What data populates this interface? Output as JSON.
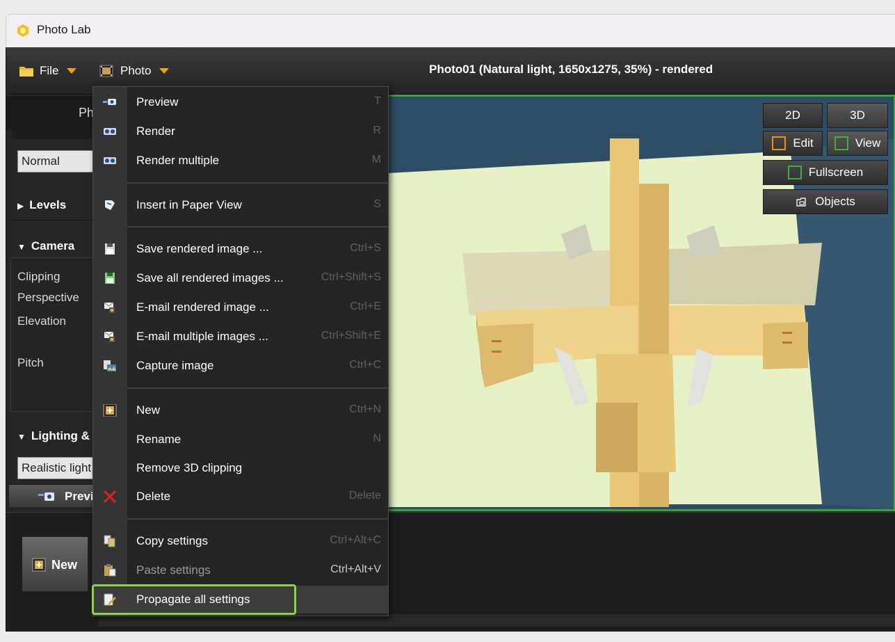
{
  "window": {
    "app_title": "Photo Lab"
  },
  "menubar": {
    "file_label": "File",
    "photo_label": "Photo",
    "document_title": "Photo01 (Natural light, 1650x1275, 35%) - rendered"
  },
  "left_panel": {
    "tab_label": "Ph",
    "view_mode_value": "Normal",
    "levels_label": "Levels",
    "camera_label": "Camera",
    "camera_fields": [
      "Clipping",
      "Perspective",
      "Elevation",
      "Pitch"
    ],
    "lighting_label": "Lighting &",
    "lighting_value": "Realistic light",
    "preview_label": "Previ"
  },
  "bottom": {
    "new_label": "New"
  },
  "viewport_buttons": {
    "two_d": "2D",
    "three_d": "3D",
    "edit": "Edit",
    "view": "View",
    "fullscreen": "Fullscreen",
    "objects": "Objects"
  },
  "photo_menu": {
    "items": [
      {
        "icon": "camera-preview-icon",
        "label": "Preview",
        "shortcut": "T"
      },
      {
        "icon": "render-icon",
        "label": "Render",
        "shortcut": "R"
      },
      {
        "icon": "render-multiple-icon",
        "label": "Render multiple",
        "shortcut": "M"
      },
      {
        "icon": "paper-view-icon",
        "label": "Insert in Paper View",
        "shortcut": "S"
      },
      {
        "icon": "save-icon",
        "label": "Save rendered image ...",
        "shortcut": "Ctrl+S"
      },
      {
        "icon": "save-all-icon",
        "label": "Save all rendered images ...",
        "shortcut": "Ctrl+Shift+S"
      },
      {
        "icon": "email-icon",
        "label": "E-mail rendered image ...",
        "shortcut": "Ctrl+E"
      },
      {
        "icon": "email-multiple-icon",
        "label": "E-mail multiple images ...",
        "shortcut": "Ctrl+Shift+E"
      },
      {
        "icon": "capture-icon",
        "label": "Capture image",
        "shortcut": "Ctrl+C"
      },
      {
        "icon": "new-photo-icon",
        "label": "New",
        "shortcut": "Ctrl+N"
      },
      {
        "icon": "",
        "label": "Rename",
        "shortcut": "N"
      },
      {
        "icon": "",
        "label": "Remove 3D clipping",
        "shortcut": ""
      },
      {
        "icon": "delete-icon",
        "label": "Delete",
        "shortcut": "Delete"
      },
      {
        "icon": "copy-settings-icon",
        "label": "Copy settings",
        "shortcut": "Ctrl+Alt+C"
      },
      {
        "icon": "paste-settings-icon",
        "label": "Paste settings",
        "shortcut": "Ctrl+Alt+V"
      },
      {
        "icon": "propagate-icon",
        "label": "Propagate all settings",
        "shortcut": ""
      }
    ]
  },
  "colors": {
    "accent_orange": "#f0a020",
    "viewport_border_green": "#3aa23a",
    "highlight_green": "#8fd14f",
    "delete_red": "#e02020"
  }
}
